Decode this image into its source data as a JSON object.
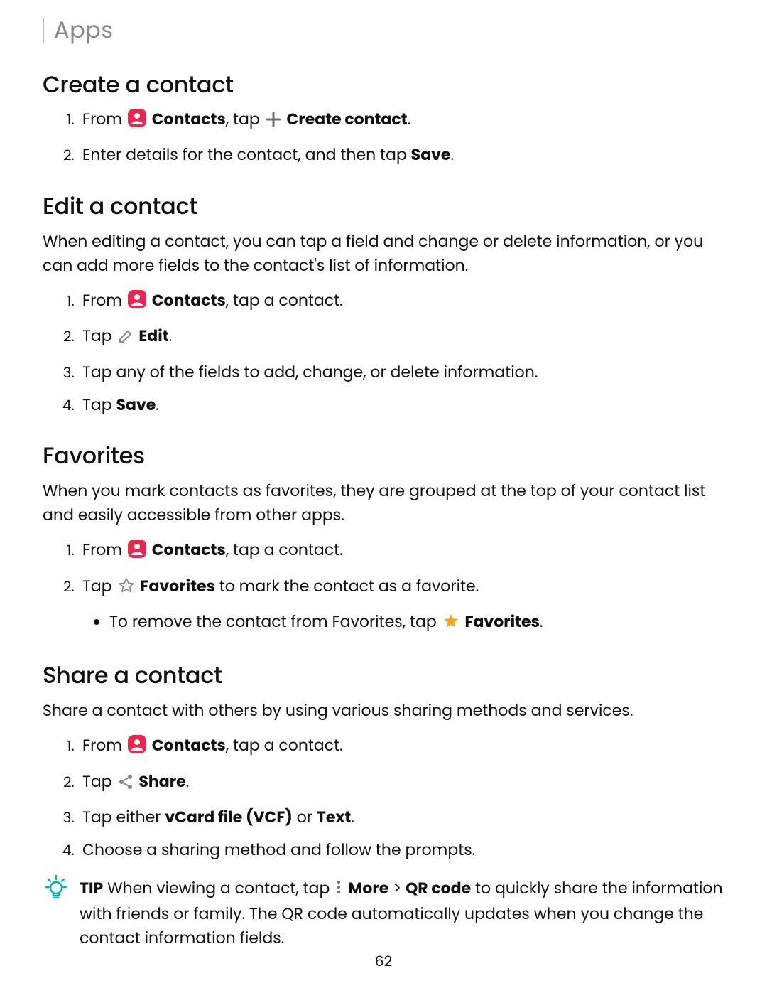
{
  "header_tab": "Apps",
  "page_number": "62",
  "sections": {
    "create": {
      "title": "Create a contact",
      "step1_from": "From ",
      "step1_contacts": "Contacts",
      "step1_tap": ", tap ",
      "step1_create_contact": "Create contact",
      "step1_period": ".",
      "step2_a": "Enter details for the contact, and then tap ",
      "step2_bold": "Save",
      "step2_b": "."
    },
    "edit": {
      "title": "Edit a contact",
      "lead": "When editing a contact, you can tap a field and change or delete information, or you can add more fields to the contact's list of information.",
      "step1_from": "From ",
      "step1_contacts": "Contacts",
      "step1_rest": ", tap a contact.",
      "step2_tap": "Tap ",
      "step2_edit": "Edit",
      "step2_period": ".",
      "step3": "Tap any of the fields to add, change, or delete information.",
      "step4_a": "Tap ",
      "step4_bold": "Save",
      "step4_b": "."
    },
    "favorites": {
      "title": "Favorites",
      "lead": "When you mark contacts as favorites, they are grouped at the top of your contact list and easily accessible from other apps.",
      "step1_from": "From ",
      "step1_contacts": "Contacts",
      "step1_rest": ", tap a contact.",
      "step2_tap": "Tap ",
      "step2_fav": "Favorites",
      "step2_rest": " to mark the contact as a favorite.",
      "sub_a": "To remove the contact from Favorites, tap ",
      "sub_fav": "Favorites",
      "sub_b": "."
    },
    "share": {
      "title": "Share a contact",
      "lead": "Share a contact with others by using various sharing methods and services.",
      "step1_from": "From ",
      "step1_contacts": "Contacts",
      "step1_rest": ", tap a contact.",
      "step2_tap": "Tap ",
      "step2_share": "Share",
      "step2_period": ".",
      "step3_a": "Tap either ",
      "step3_vcf": "vCard file (VCF)",
      "step3_or": " or ",
      "step3_text": "Text",
      "step3_b": ".",
      "step4": "Choose a sharing method and follow the prompts."
    },
    "tip": {
      "label": "TIP",
      "a": "  When viewing a contact, tap ",
      "more": "More",
      "gt": " > ",
      "qr": "QR code",
      "b": " to quickly share the information with friends or family. The QR code automatically updates when you change the contact information fields."
    }
  }
}
